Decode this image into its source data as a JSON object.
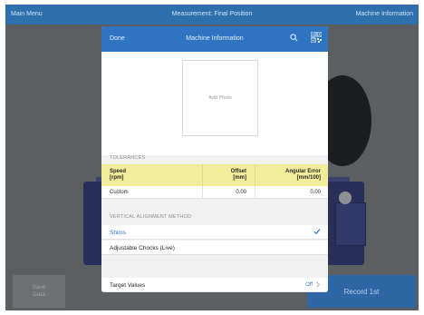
{
  "topbar": {
    "left": "Main Menu",
    "center": "Measurement: Final Position",
    "right": "Machine Information"
  },
  "modal": {
    "done": "Done",
    "title": "Machine Information",
    "add_photo": "Add Photo",
    "tolerances": {
      "section_label": "TOLERANCES",
      "col_speed": [
        "Speed",
        "[rpm]"
      ],
      "col_offset": [
        "Offset",
        "[mm]"
      ],
      "col_angular": [
        "Angular Error",
        "[mm/100]"
      ],
      "row": {
        "name": "Custom",
        "offset": "0.00",
        "angular": "0.00"
      }
    },
    "method": {
      "section_label": "VERTICAL ALIGNMENT METHOD",
      "options": [
        {
          "label": "Shims",
          "selected": true
        },
        {
          "label": "Adjustable Chocks (Live)",
          "selected": false
        }
      ]
    },
    "target": {
      "label": "Target Values",
      "value": "Off"
    }
  },
  "buttons": {
    "save": [
      "Save",
      "Data"
    ],
    "record": "Record 1st"
  },
  "colors": {
    "accent": "#2f74c0",
    "header_bar": "#2e6fae",
    "tolerance_highlight": "#f1ed9a"
  },
  "icons": [
    "search-icon",
    "qr-code-icon",
    "checkmark-icon",
    "chevron-right-icon"
  ]
}
